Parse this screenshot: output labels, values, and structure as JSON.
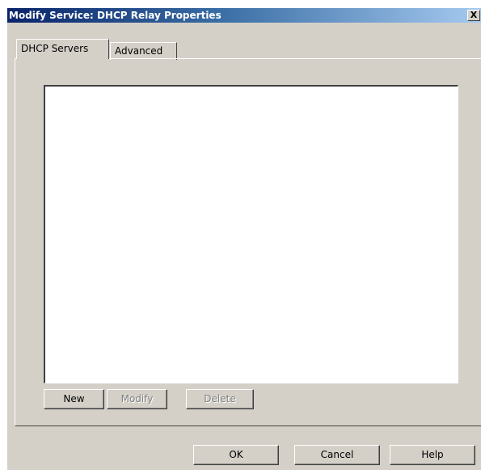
{
  "window": {
    "title": "Modify Service: DHCP Relay Properties",
    "close_glyph": "X"
  },
  "tabs": [
    {
      "label": "DHCP Servers",
      "selected": true
    },
    {
      "label": "Advanced",
      "selected": false
    }
  ],
  "servers_list": {
    "items": []
  },
  "list_buttons": {
    "new": "New",
    "modify": "Modify",
    "delete": "Delete"
  },
  "dialog_buttons": {
    "ok": "OK",
    "cancel": "Cancel",
    "help": "Help"
  },
  "colors": {
    "titlebar_start": "#0a246a",
    "titlebar_end": "#a6caf0",
    "face": "#d4d0c8",
    "disabled_text": "#808080"
  }
}
